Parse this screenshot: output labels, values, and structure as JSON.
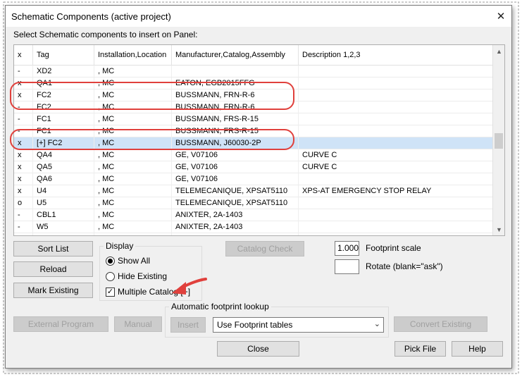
{
  "window": {
    "title": "Schematic Components (active project)",
    "close_glyph": "✕",
    "instruction": "Select Schematic components to insert on Panel:"
  },
  "grid": {
    "columns": [
      "x",
      "Tag",
      "Installation,Location",
      "Manufacturer,Catalog,Assembly",
      "Description 1,2,3"
    ],
    "rows": [
      {
        "x": "-",
        "tag": "XD2",
        "loc": ", MC",
        "mfr": "",
        "desc": ""
      },
      {
        "x": "x",
        "tag": "QA1",
        "loc": ", MC",
        "mfr": "EATON, EGB2015FFG",
        "desc": ""
      },
      {
        "x": "x",
        "tag": "FC2",
        "loc": ", MC",
        "mfr": "BUSSMANN, FRN-R-6",
        "desc": ""
      },
      {
        "x": "-",
        "tag": "FC2",
        "loc": ", MC",
        "mfr": "BUSSMANN, FRN-R-6",
        "desc": ""
      },
      {
        "x": "-",
        "tag": "FC1",
        "loc": ", MC",
        "mfr": "BUSSMANN, FRS-R-15",
        "desc": ""
      },
      {
        "x": "-",
        "tag": "FC1",
        "loc": ", MC",
        "mfr": "BUSSMANN, FRS-R-15",
        "desc": ""
      },
      {
        "x": "x",
        "tag": "[+] FC2",
        "loc": ", MC",
        "mfr": "BUSSMANN, J60030-2P",
        "desc": ""
      },
      {
        "x": "x",
        "tag": "QA4",
        "loc": ", MC",
        "mfr": "GE, V07106",
        "desc": " CURVE C"
      },
      {
        "x": "x",
        "tag": "QA5",
        "loc": ", MC",
        "mfr": "GE, V07106",
        "desc": "CURVE C"
      },
      {
        "x": "x",
        "tag": "QA6",
        "loc": ", MC",
        "mfr": "GE, V07106",
        "desc": ""
      },
      {
        "x": "x",
        "tag": "U4",
        "loc": ", MC",
        "mfr": "TELEMECANIQUE, XPSAT5110",
        "desc": "XPS-AT EMERGENCY STOP RELAY"
      },
      {
        "x": "o",
        "tag": "U5",
        "loc": ", MC",
        "mfr": "TELEMECANIQUE, XPSAT5110",
        "desc": ""
      },
      {
        "x": "-",
        "tag": "CBL1",
        "loc": ", MC",
        "mfr": "ANIXTER, 2A-1403",
        "desc": ""
      },
      {
        "x": "-",
        "tag": "W5",
        "loc": ", MC",
        "mfr": "ANIXTER, 2A-1403",
        "desc": ""
      },
      {
        "x": "-",
        "tag": "",
        "loc": "",
        "mfr": "",
        "desc": ""
      }
    ],
    "highlighted_row": 6
  },
  "buttons": {
    "sort_list": "Sort List",
    "reload": "Reload",
    "mark_existing": "Mark Existing",
    "catalog_check": "Catalog Check",
    "external_program": "External Program",
    "manual": "Manual",
    "insert": "Insert",
    "convert_existing": "Convert Existing",
    "close": "Close",
    "pick_file": "Pick File",
    "help": "Help"
  },
  "display": {
    "legend": "Display",
    "show_all": "Show All",
    "hide_existing": "Hide Existing",
    "multiple_catalog": "Multiple Catalog [+]",
    "show_all_selected": true,
    "multiple_catalog_checked": true,
    "check_glyph": "✓"
  },
  "footprint": {
    "scale_value": "1.000",
    "scale_label": "Footprint scale",
    "rotate_value": "",
    "rotate_label": "Rotate (blank=\"ask\")",
    "lookup_legend": "Automatic footprint lookup",
    "lookup_selected": "Use Footprint tables",
    "chevron": "⌄"
  },
  "colors": {
    "annotation": "#e0403c",
    "selected_row": "#cfe3f7"
  }
}
